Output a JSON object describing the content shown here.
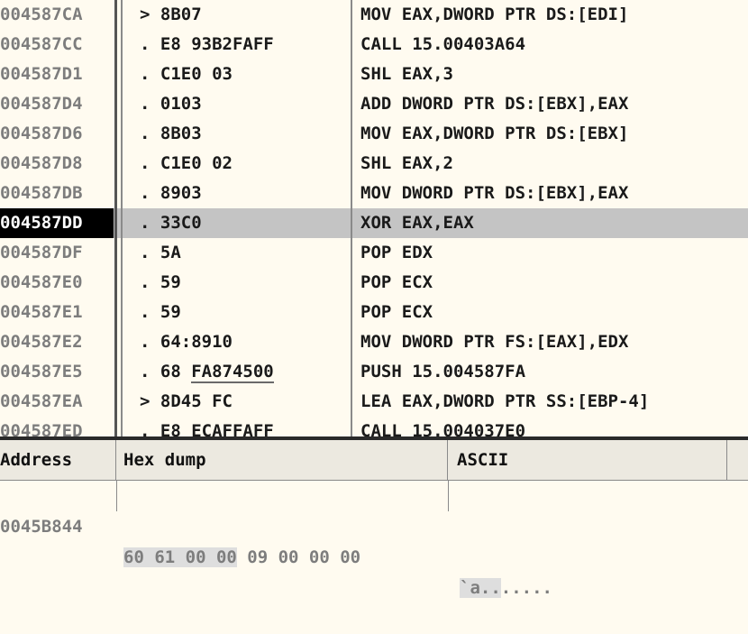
{
  "cpu_rows": [
    {
      "addr": "004587CA",
      "hex_pre": "> 8B07",
      "hex_u": "",
      "disasm": "MOV EAX,DWORD PTR DS:[EDI]",
      "selected": false
    },
    {
      "addr": "004587CC",
      "hex_pre": ". E8 93B2FAFF",
      "hex_u": "",
      "disasm": "CALL 15.00403A64",
      "selected": false
    },
    {
      "addr": "004587D1",
      "hex_pre": ". C1E0 03",
      "hex_u": "",
      "disasm": "SHL EAX,3",
      "selected": false
    },
    {
      "addr": "004587D4",
      "hex_pre": ". 0103",
      "hex_u": "",
      "disasm": "ADD DWORD PTR DS:[EBX],EAX",
      "selected": false
    },
    {
      "addr": "004587D6",
      "hex_pre": ". 8B03",
      "hex_u": "",
      "disasm": "MOV EAX,DWORD PTR DS:[EBX]",
      "selected": false
    },
    {
      "addr": "004587D8",
      "hex_pre": ". C1E0 02",
      "hex_u": "",
      "disasm": "SHL EAX,2",
      "selected": false
    },
    {
      "addr": "004587DB",
      "hex_pre": ". 8903",
      "hex_u": "",
      "disasm": "MOV DWORD PTR DS:[EBX],EAX",
      "selected": false
    },
    {
      "addr": "004587DD",
      "hex_pre": ". 33C0",
      "hex_u": "",
      "disasm": "XOR EAX,EAX",
      "selected": true
    },
    {
      "addr": "004587DF",
      "hex_pre": ". 5A",
      "hex_u": "",
      "disasm": "POP EDX",
      "selected": false
    },
    {
      "addr": "004587E0",
      "hex_pre": ". 59",
      "hex_u": "",
      "disasm": "POP ECX",
      "selected": false
    },
    {
      "addr": "004587E1",
      "hex_pre": ". 59",
      "hex_u": "",
      "disasm": "POP ECX",
      "selected": false
    },
    {
      "addr": "004587E2",
      "hex_pre": ". 64:8910",
      "hex_u": "",
      "disasm": "MOV DWORD PTR FS:[EAX],EDX",
      "selected": false
    },
    {
      "addr": "004587E5",
      "hex_pre": ". 68 ",
      "hex_u": "FA874500",
      "disasm": "PUSH 15.004587FA",
      "selected": false
    },
    {
      "addr": "004587EA",
      "hex_pre": "> 8D45 FC",
      "hex_u": "",
      "disasm": "LEA EAX,DWORD PTR SS:[EBP-4]",
      "selected": false
    },
    {
      "addr": "004587ED",
      "hex_pre": ". E8 ECAFFAFF",
      "hex_u": "",
      "disasm": "CALL 15.004037E0",
      "selected": false
    }
  ],
  "dump": {
    "headers": {
      "address": "Address",
      "hex": "Hex dump",
      "ascii": "ASCII"
    },
    "row": {
      "addr": "0045B844",
      "bytes_hl": "60 61 00 00",
      "bytes_rest": " 09 00 00 00",
      "ascii_hl": "`a..",
      "ascii_rest": "....."
    }
  }
}
